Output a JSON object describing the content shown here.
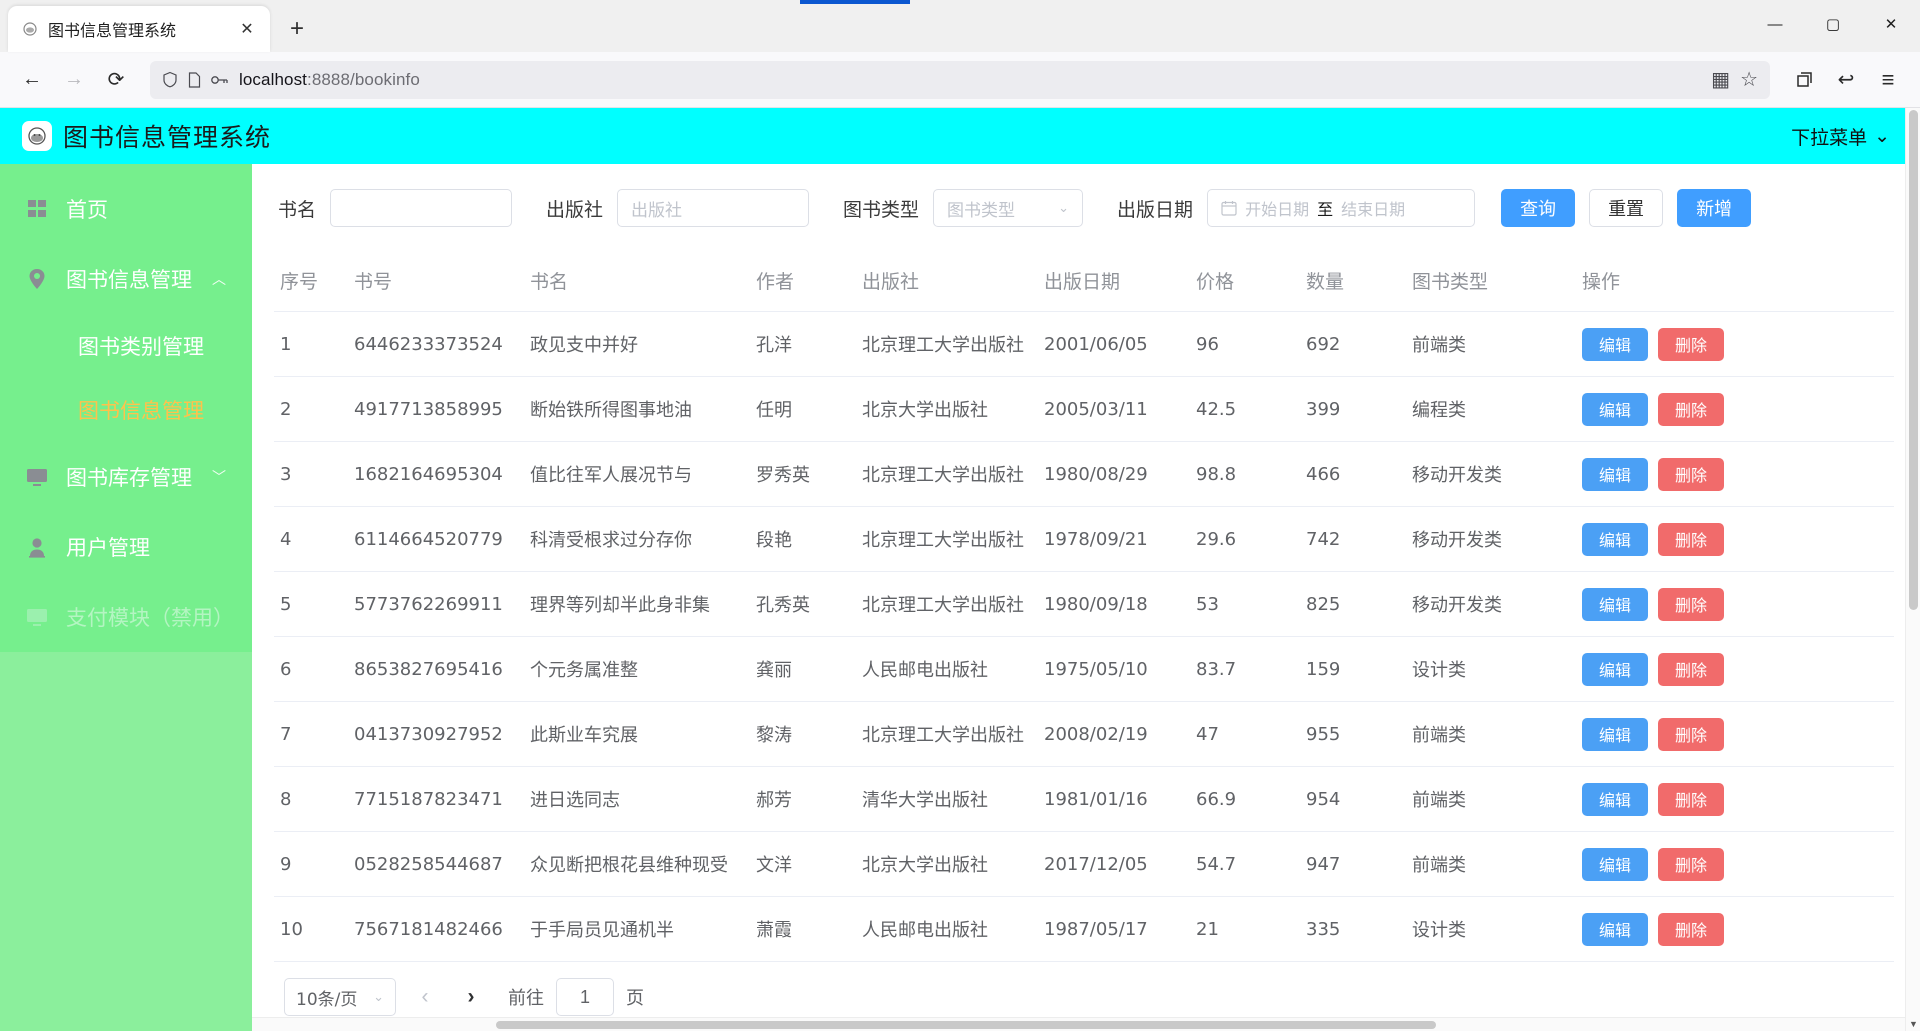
{
  "browser": {
    "tab": {
      "title": "图书信息管理系统",
      "favicon": "book-favicon",
      "close": "✕"
    },
    "newtab_label": "+",
    "window": {
      "minimize": "—",
      "maximize": "▢",
      "close": "✕"
    },
    "nav": {
      "back": "←",
      "forward": "→",
      "reload": "⟳"
    },
    "url": {
      "host": "localhost",
      "rest": ":8888/bookinfo",
      "shield": "🛡",
      "page": "🗋",
      "key": "⚷"
    },
    "toolbar": {
      "qr": "▦",
      "bookmark": "☆",
      "extensions": "✂",
      "history": "↩",
      "menu": "≡"
    }
  },
  "app": {
    "title": "图书信息管理系统",
    "dropdown_label": "下拉菜单",
    "dropdown_caret": "⌄",
    "logo_glyph": "☻"
  },
  "sidebar": {
    "items": [
      {
        "label": "首页",
        "icon": "grid-icon",
        "arrow": "",
        "kind": "item"
      },
      {
        "label": "图书信息管理",
        "icon": "location-pin-icon",
        "arrow": "︿",
        "kind": "item"
      },
      {
        "label": "图书类别管理",
        "icon": "",
        "arrow": "",
        "kind": "sub"
      },
      {
        "label": "图书信息管理",
        "icon": "",
        "arrow": "",
        "kind": "sub-active"
      },
      {
        "label": "图书库存管理",
        "icon": "monitor-icon",
        "arrow": "﹀",
        "kind": "item"
      },
      {
        "label": "用户管理",
        "icon": "user-icon",
        "arrow": "",
        "kind": "item"
      },
      {
        "label": "支付模块（禁用）",
        "icon": "monitor-icon",
        "arrow": "",
        "kind": "disabled"
      }
    ]
  },
  "filters": {
    "bookname": {
      "label": "书名",
      "value": "",
      "placeholder": ""
    },
    "publisher": {
      "label": "出版社",
      "value": "",
      "placeholder": "出版社"
    },
    "booktype": {
      "label": "图书类型",
      "value": "",
      "placeholder": "图书类型",
      "caret": "⌄"
    },
    "pubdate": {
      "label": "出版日期",
      "calendar_icon": "▤",
      "start_placeholder": "开始日期",
      "separator": "至",
      "end_placeholder": "结束日期"
    },
    "buttons": {
      "search": "查询",
      "reset": "重置",
      "add": "新增"
    }
  },
  "table": {
    "columns": [
      "序号",
      "书号",
      "书名",
      "作者",
      "出版社",
      "出版日期",
      "价格",
      "数量",
      "图书类型",
      "操作"
    ],
    "row_actions": {
      "edit": "编辑",
      "delete": "删除"
    },
    "rows": [
      {
        "idx": "1",
        "isbn": "6446233373524",
        "name": "政见支中并好",
        "author": "孔洋",
        "pub": "北京理工大学出版社",
        "date": "2001/06/05",
        "price": "96",
        "qty": "692",
        "type": "前端类"
      },
      {
        "idx": "2",
        "isbn": "4917713858995",
        "name": "断始铁所得图事地油",
        "author": "任明",
        "pub": "北京大学出版社",
        "date": "2005/03/11",
        "price": "42.5",
        "qty": "399",
        "type": "编程类"
      },
      {
        "idx": "3",
        "isbn": "1682164695304",
        "name": "值比往军人展况节与",
        "author": "罗秀英",
        "pub": "北京理工大学出版社",
        "date": "1980/08/29",
        "price": "98.8",
        "qty": "466",
        "type": "移动开发类"
      },
      {
        "idx": "4",
        "isbn": "6114664520779",
        "name": "科清受根求过分存你",
        "author": "段艳",
        "pub": "北京理工大学出版社",
        "date": "1978/09/21",
        "price": "29.6",
        "qty": "742",
        "type": "移动开发类"
      },
      {
        "idx": "5",
        "isbn": "5773762269911",
        "name": "理界等列却半此身非集",
        "author": "孔秀英",
        "pub": "北京理工大学出版社",
        "date": "1980/09/18",
        "price": "53",
        "qty": "825",
        "type": "移动开发类"
      },
      {
        "idx": "6",
        "isbn": "8653827695416",
        "name": "个元务属准整",
        "author": "龚丽",
        "pub": "人民邮电出版社",
        "date": "1975/05/10",
        "price": "83.7",
        "qty": "159",
        "type": "设计类"
      },
      {
        "idx": "7",
        "isbn": "0413730927952",
        "name": "此斯业车究展",
        "author": "黎涛",
        "pub": "北京理工大学出版社",
        "date": "2008/02/19",
        "price": "47",
        "qty": "955",
        "type": "前端类"
      },
      {
        "idx": "8",
        "isbn": "7715187823471",
        "name": "进日选同志",
        "author": "郝芳",
        "pub": "清华大学出版社",
        "date": "1981/01/16",
        "price": "66.9",
        "qty": "954",
        "type": "前端类"
      },
      {
        "idx": "9",
        "isbn": "0528258544687",
        "name": "众见断把根花县维种现受",
        "author": "文洋",
        "pub": "北京大学出版社",
        "date": "2017/12/05",
        "price": "54.7",
        "qty": "947",
        "type": "前端类"
      },
      {
        "idx": "10",
        "isbn": "7567181482466",
        "name": "于手局员见通机半",
        "author": "萧霞",
        "pub": "人民邮电出版社",
        "date": "1987/05/17",
        "price": "21",
        "qty": "335",
        "type": "设计类"
      }
    ]
  },
  "pagination": {
    "page_size": "10条/页",
    "caret": "⌄",
    "prev": "‹",
    "next": "›",
    "goto_label": "前往",
    "page_value": "1",
    "page_suffix": "页"
  },
  "colors": {
    "header_bg": "#00ffff",
    "sidebar_bg": "#76ef8d",
    "active_menu": "#ffc24b",
    "primary": "#409eff",
    "edit": "#4ba0f5",
    "delete": "#f16b6b"
  }
}
